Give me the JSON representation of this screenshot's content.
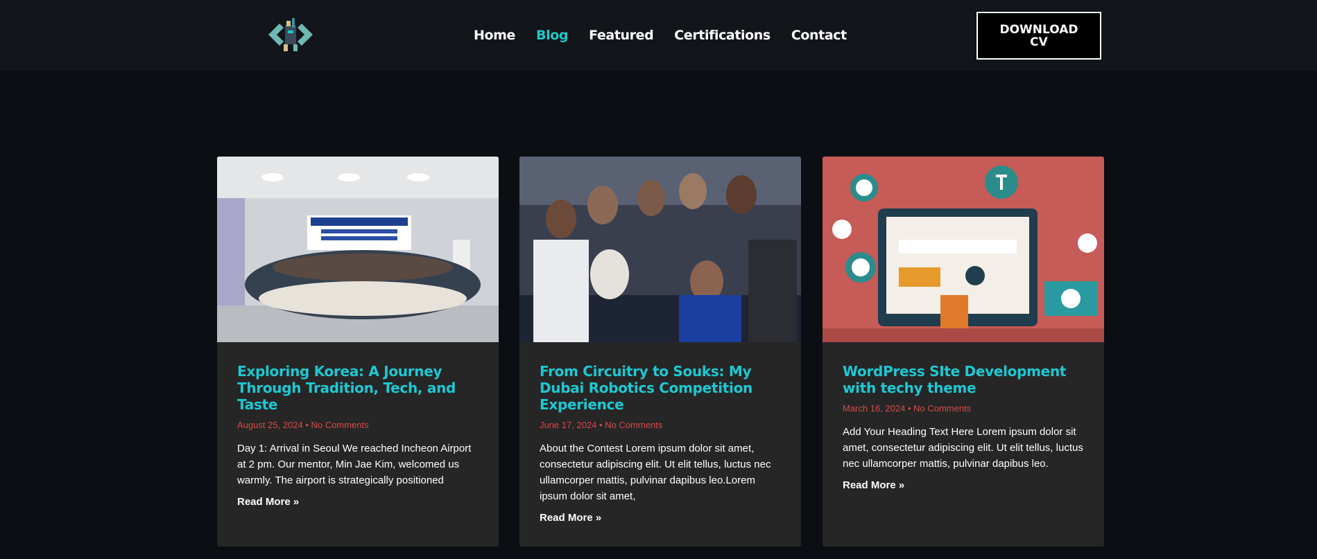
{
  "nav": {
    "items": [
      {
        "label": "Home",
        "active": false
      },
      {
        "label": "Blog",
        "active": true
      },
      {
        "label": "Featured",
        "active": false
      },
      {
        "label": "Certifications",
        "active": false
      },
      {
        "label": "Contact",
        "active": false
      }
    ],
    "cv_button": "DOWNLOAD CV",
    "accent_color": "#1ec8c8"
  },
  "posts": [
    {
      "title": "Exploring Korea: A Journey Through Tradition, Tech, and Taste",
      "date": "August 25, 2024",
      "comments": "No Comments",
      "excerpt": "Day 1: Arrival in Seoul We reached Incheon Airport at 2 pm. Our mentor, Min Jae Kim, welcomed us warmly. The airport is strategically positioned",
      "read_more": "Read More »",
      "image_icon": "group-photo-classroom"
    },
    {
      "title": "From Circuitry to Souks: My Dubai Robotics Competition Experience",
      "date": "June 17, 2024",
      "comments": "No Comments",
      "excerpt": "About the Contest Lorem ipsum dolor sit amet, consectetur adipiscing elit. Ut elit tellus, luctus nec ullamcorper mattis, pulvinar dapibus leo.Lorem ipsum dolor sit amet,",
      "read_more": "Read More »",
      "image_icon": "group-selfie-photo"
    },
    {
      "title": "WordPress SIte Development with techy theme",
      "date": "March 16, 2024",
      "comments": "No Comments",
      "excerpt": "Add Your Heading Text Here Lorem ipsum dolor sit amet, consectetur adipiscing elit. Ut elit tellus, luctus nec ullamcorper mattis, pulvinar dapibus leo.",
      "read_more": "Read More »",
      "image_icon": "wordpress-illustration"
    }
  ],
  "colors": {
    "background": "#0b0e13",
    "header": "#121519",
    "card": "#262626",
    "title": "#1ec8d2",
    "meta": "#d94a4a"
  }
}
